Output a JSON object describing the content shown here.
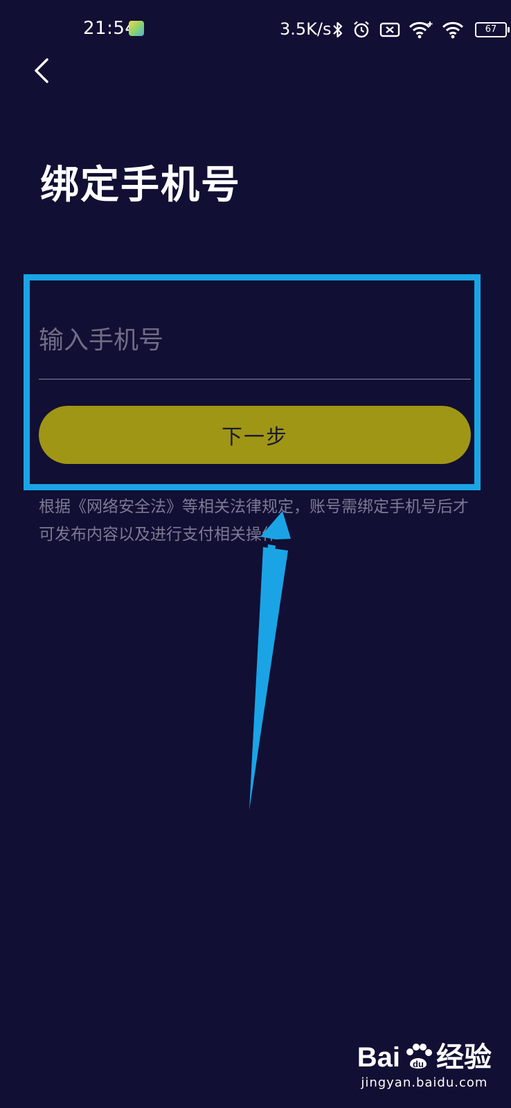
{
  "status_bar": {
    "time": "21:54",
    "network_speed": "3.5K/s",
    "battery_level": "67",
    "icons": [
      "bluetooth-icon",
      "alarm-icon",
      "sim-off-icon",
      "wifi-plus-icon",
      "wifi-icon",
      "battery-icon"
    ]
  },
  "nav": {
    "back_icon": "chevron-left-icon"
  },
  "page": {
    "title": "绑定手机号"
  },
  "form": {
    "phone_placeholder": "输入手机号",
    "phone_value": "",
    "next_label": "下一步"
  },
  "notice": {
    "text": "根据《网络安全法》等相关法律规定，账号需绑定手机号后才可发布内容以及进行支付相关操作"
  },
  "colors": {
    "background": "#110f33",
    "button": "#9f9615",
    "highlight": "#1aa4e6",
    "placeholder": "#6f6d86",
    "notice": "#7c7a94"
  },
  "watermark": {
    "brand_left": "Bai",
    "brand_right": "经验",
    "url": "jingyan.baidu.com"
  }
}
